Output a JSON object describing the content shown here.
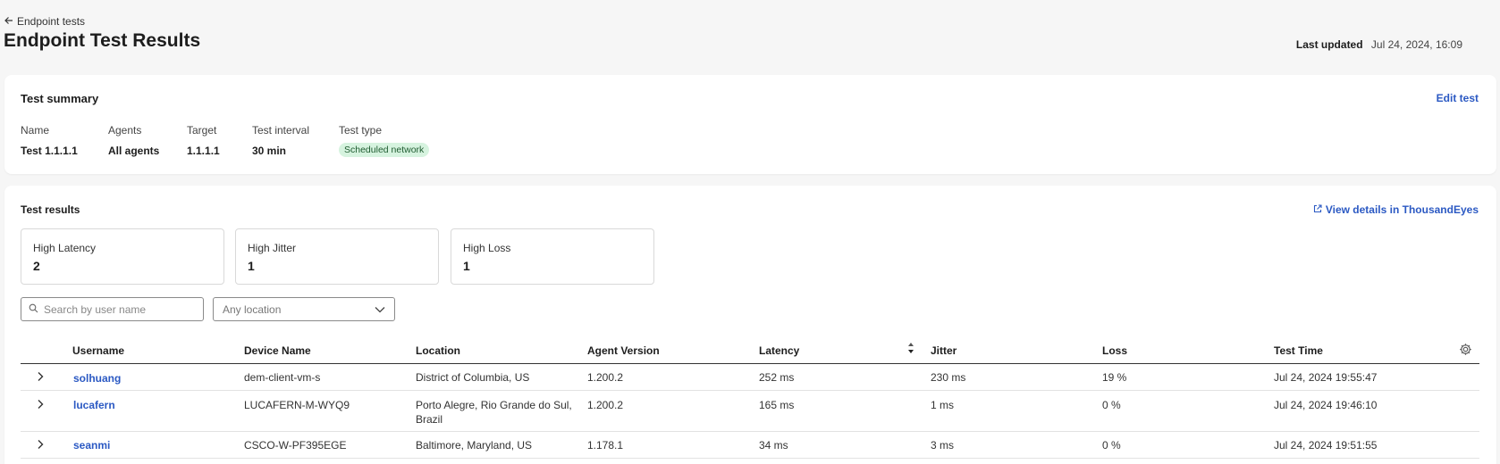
{
  "header": {
    "back_label": "Endpoint tests",
    "title": "Endpoint Test Results",
    "last_updated_label": "Last updated",
    "last_updated_value": "Jul 24, 2024, 16:09"
  },
  "summary": {
    "title": "Test summary",
    "edit_label": "Edit test",
    "fields": {
      "name_key": "Name",
      "name_val": "Test 1.1.1.1",
      "agents_key": "Agents",
      "agents_val": "All agents",
      "target_key": "Target",
      "target_val": "1.1.1.1",
      "interval_key": "Test interval",
      "interval_val": "30 min",
      "type_key": "Test type",
      "type_val": "Scheduled network"
    }
  },
  "results": {
    "title": "Test results",
    "te_link_label": "View details in ThousandEyes",
    "stats": [
      {
        "label": "High Latency",
        "value": "2"
      },
      {
        "label": "High Jitter",
        "value": "1"
      },
      {
        "label": "High Loss",
        "value": "1"
      }
    ],
    "search_placeholder": "Search by user name",
    "location_select": "Any location",
    "columns": [
      "Username",
      "Device Name",
      "Location",
      "Agent Version",
      "Latency",
      "Jitter",
      "Loss",
      "Test Time"
    ],
    "rows": [
      {
        "user": "solhuang",
        "device": "dem-client-vm-s",
        "location": "District of Columbia, US",
        "location2": "",
        "version": "1.200.2",
        "latency": "252 ms",
        "jitter": "230 ms",
        "loss": "19 %",
        "time": "Jul 24, 2024 19:55:47"
      },
      {
        "user": "lucafern",
        "device": "LUCAFERN-M-WYQ9",
        "location": "Porto Alegre, Rio Grande do Sul,",
        "location2": "Brazil",
        "version": "1.200.2",
        "latency": "165 ms",
        "jitter": "1 ms",
        "loss": "0 %",
        "time": "Jul 24, 2024 19:46:10"
      },
      {
        "user": "seanmi",
        "device": "CSCO-W-PF395EGE",
        "location": "Baltimore, Maryland, US",
        "location2": "",
        "version": "1.178.1",
        "latency": "34 ms",
        "jitter": "3 ms",
        "loss": "0 %",
        "time": "Jul 24, 2024 19:51:55"
      }
    ]
  },
  "colors": {
    "accent": "#2b59c3",
    "badge_bg": "#d6f3df",
    "background": "#f6f6f6"
  },
  "icons": [
    "arrow-left-icon",
    "external-link-icon",
    "search-icon",
    "chevron-down-icon",
    "sort-icon",
    "gear-icon",
    "chevron-right-icon"
  ]
}
